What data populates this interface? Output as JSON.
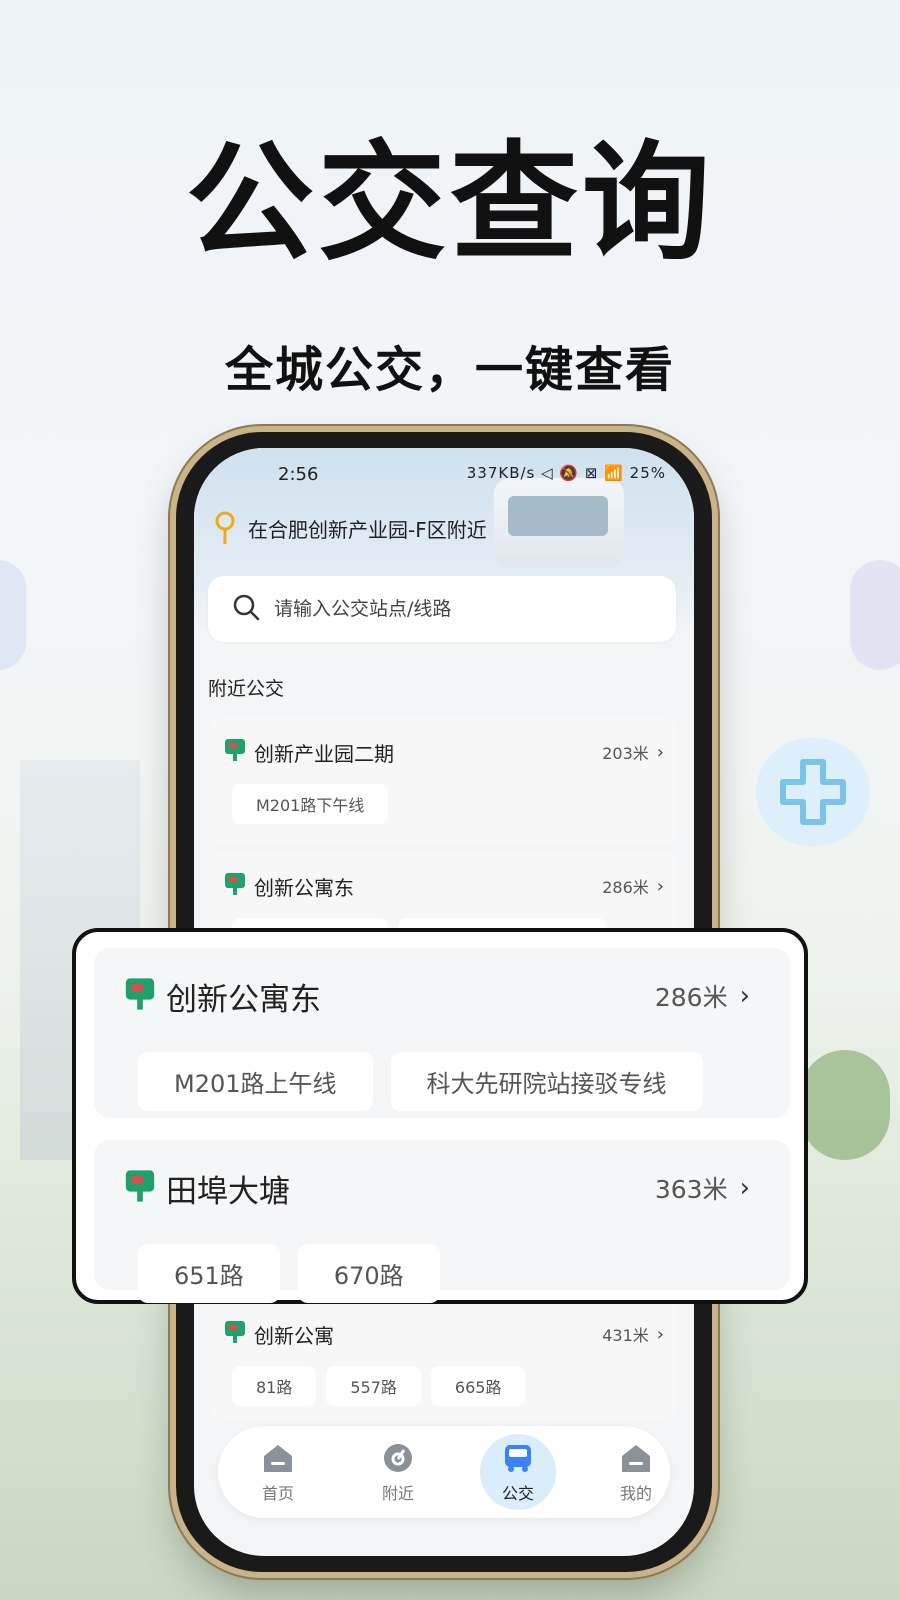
{
  "hero": {
    "title": "公交查询",
    "subtitle": "全城公交，一键查看"
  },
  "status_bar": {
    "time": "2:56",
    "right": "337KB/s ◁ 🔕 ⊠ 📶 25%"
  },
  "location": {
    "text": "在合肥创新产业园-F区附近"
  },
  "search": {
    "placeholder": "请输入公交站点/线路"
  },
  "nearby": {
    "title": "附近公交",
    "stations": [
      {
        "name": "创新产业园二期",
        "distance": "203米",
        "routes": [
          "M201路下午线"
        ]
      },
      {
        "name": "创新公寓东",
        "distance": "286米",
        "routes": [
          "M201路上午线",
          "科大先研院站接驳专线"
        ]
      },
      {
        "name": "创新公寓",
        "distance": "431米",
        "routes": [
          "81路",
          "557路",
          "665路"
        ]
      }
    ]
  },
  "overlay": {
    "stations": [
      {
        "name": "创新公寓东",
        "distance": "286米",
        "routes": [
          "M201路上午线",
          "科大先研院站接驳专线"
        ]
      },
      {
        "name": "田埠大塘",
        "distance": "363米",
        "routes": [
          "651路",
          "670路"
        ]
      }
    ]
  },
  "tabbar": {
    "tabs": [
      {
        "label": "首页",
        "icon": "home-icon"
      },
      {
        "label": "附近",
        "icon": "nearby-icon"
      },
      {
        "label": "公交",
        "icon": "bus-icon",
        "active": true
      },
      {
        "label": "我的",
        "icon": "profile-icon"
      }
    ]
  },
  "colors": {
    "stop_icon_green": "#22a06b",
    "stop_icon_red": "#e5484d",
    "active_tab_bg": "#d9edfa",
    "bus_icon_blue": "#3b82f6"
  }
}
